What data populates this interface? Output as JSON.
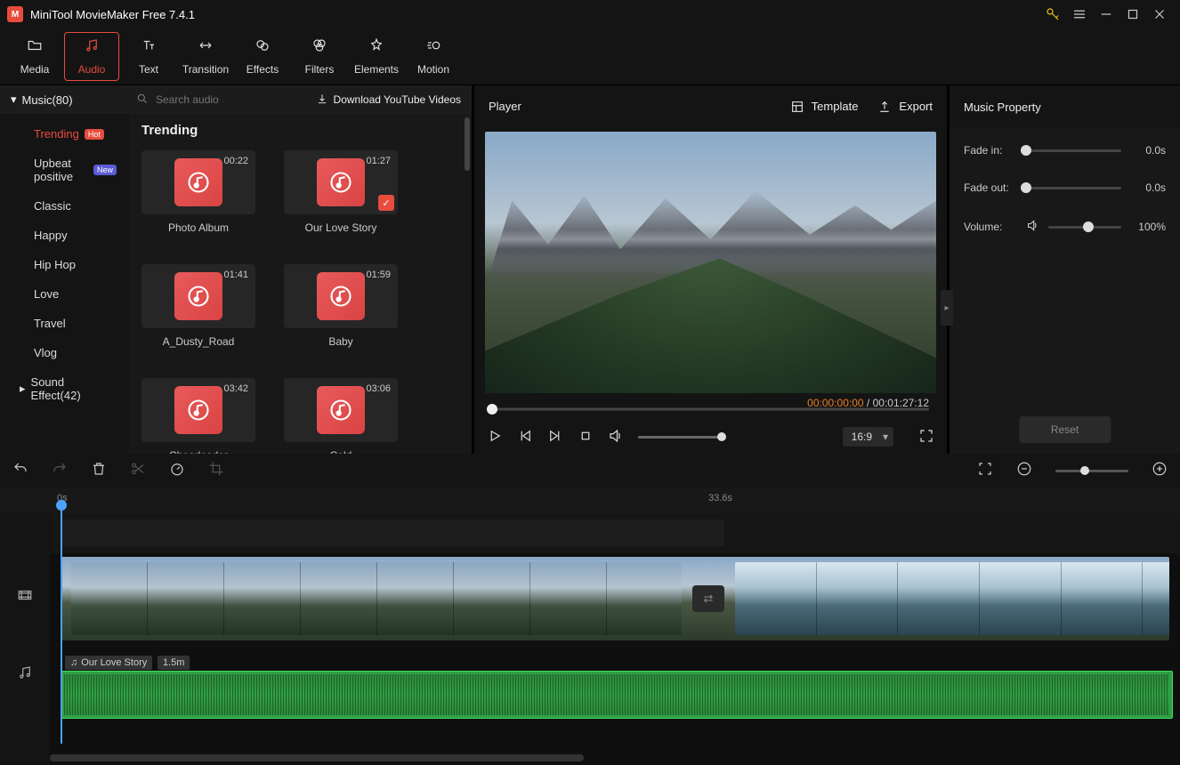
{
  "app": {
    "title": "MiniTool MovieMaker Free 7.4.1"
  },
  "ribbon": [
    {
      "label": "Media",
      "icon": "folder"
    },
    {
      "label": "Audio",
      "icon": "music",
      "active": true
    },
    {
      "label": "Text",
      "icon": "text"
    },
    {
      "label": "Transition",
      "icon": "transition"
    },
    {
      "label": "Effects",
      "icon": "effects"
    },
    {
      "label": "Filters",
      "icon": "filters"
    },
    {
      "label": "Elements",
      "icon": "elements"
    },
    {
      "label": "Motion",
      "icon": "motion"
    }
  ],
  "browser": {
    "section_label": "Music(80)",
    "search_placeholder": "Search audio",
    "yt_link": "Download YouTube Videos",
    "categories": [
      {
        "label": "Trending",
        "badge": "Hot",
        "active": true
      },
      {
        "label": "Upbeat positive",
        "badge": "New",
        "badgeColor": "blue"
      },
      {
        "label": "Classic"
      },
      {
        "label": "Happy"
      },
      {
        "label": "Hip Hop"
      },
      {
        "label": "Love"
      },
      {
        "label": "Travel"
      },
      {
        "label": "Vlog"
      }
    ],
    "sound_effect_label": "Sound Effect(42)",
    "grid_title": "Trending",
    "items": [
      {
        "name": "Photo Album",
        "dur": "00:22"
      },
      {
        "name": "Our Love Story",
        "dur": "01:27",
        "checked": true
      },
      {
        "name": "A_Dusty_Road",
        "dur": "01:41"
      },
      {
        "name": "Baby",
        "dur": "01:59"
      },
      {
        "name": "Cheerleader",
        "dur": "03:42"
      },
      {
        "name": "Cold",
        "dur": "03:06"
      }
    ]
  },
  "player": {
    "title": "Player",
    "template_label": "Template",
    "export_label": "Export",
    "current_time": "00:00:00:00",
    "total_time": "00:01:27:12",
    "ratio": "16:9"
  },
  "props": {
    "title": "Music Property",
    "fade_in_label": "Fade in:",
    "fade_in_value": "0.0s",
    "fade_out_label": "Fade out:",
    "fade_out_value": "0.0s",
    "volume_label": "Volume:",
    "volume_value": "100%",
    "reset_label": "Reset"
  },
  "timeline": {
    "ruler_start": "0s",
    "ruler_mid": "33.6s",
    "audio_clip_name": "Our Love Story",
    "audio_clip_dur": "1.5m"
  }
}
